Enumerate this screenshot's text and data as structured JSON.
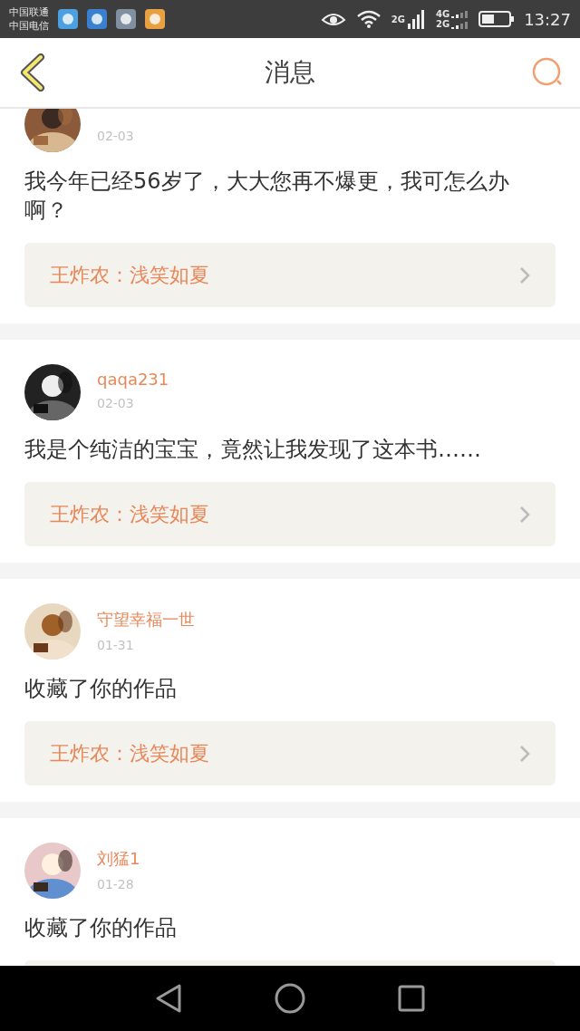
{
  "status_bar": {
    "carriers": [
      "中国联通",
      "中国电信"
    ],
    "network_labels": [
      "2G",
      "4G",
      "2G"
    ],
    "time": "13:27"
  },
  "header": {
    "title": "消息"
  },
  "messages": [
    {
      "date": "02-03",
      "text": "我今年已经56岁了，大大您再不爆更，我可怎么办啊？",
      "reply": "王炸农：浅笑如夏"
    },
    {
      "user": "qaqa231",
      "date": "02-03",
      "text": "我是个纯洁的宝宝，竟然让我发现了这本书……",
      "reply": "王炸农：浅笑如夏"
    },
    {
      "user": "守望幸福一世",
      "date": "01-31",
      "text": "收藏了你的作品",
      "reply": "王炸农：浅笑如夏"
    },
    {
      "user": "刘猛1",
      "date": "01-28",
      "text": "收藏了你的作品"
    }
  ]
}
